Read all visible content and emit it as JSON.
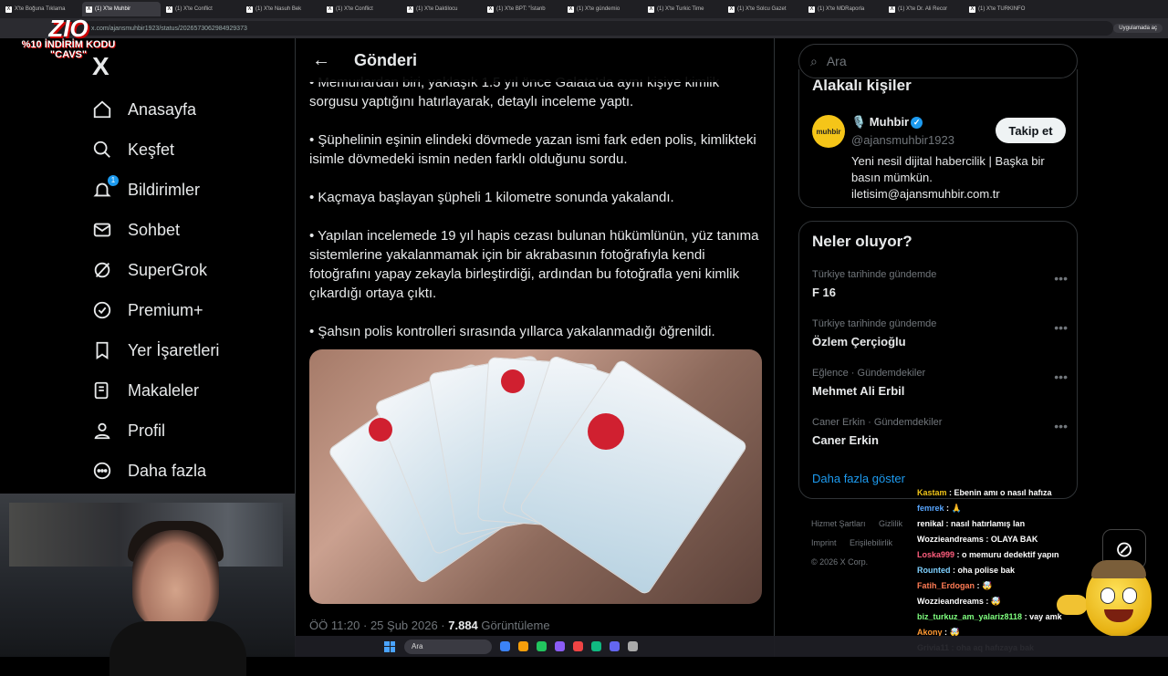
{
  "browser": {
    "tabs": [
      {
        "label": "X'te Boğuna Tıklama"
      },
      {
        "label": "(1) X'te Muhbir",
        "active": true
      },
      {
        "label": "(1) X'te Conflict"
      },
      {
        "label": "(1) X'te Nasuh Bek"
      },
      {
        "label": "(1) X'te Conflict"
      },
      {
        "label": "(1) X'te Daktilocu"
      },
      {
        "label": "(1) X'te BPT: \"İstanb"
      },
      {
        "label": "(1) X'te gündemio"
      },
      {
        "label": "(1) X'te Turkic Time"
      },
      {
        "label": "(1) X'te Solcu Gazet"
      },
      {
        "label": "(1) X'te MDRaporla"
      },
      {
        "label": "(1) X'te Dr. Ali Recor"
      },
      {
        "label": "(1) X'te TURKINFO"
      }
    ],
    "url": "x.com/ajansmuhbir1923/status/2026573062984929373",
    "app_button": "Uygulamada aç"
  },
  "overlay": {
    "brand": "ZIO",
    "promo_line1": "%10 İNDİRİM KODU",
    "promo_line2": "\"CAVS\""
  },
  "sidebar": {
    "logo": "X",
    "items": [
      {
        "label": "Anasayfa",
        "icon": "home-icon"
      },
      {
        "label": "Keşfet",
        "icon": "search-icon"
      },
      {
        "label": "Bildirimler",
        "icon": "bell-icon",
        "badge": "1"
      },
      {
        "label": "Sohbet",
        "icon": "mail-icon"
      },
      {
        "label": "SuperGrok",
        "icon": "grok-icon"
      },
      {
        "label": "Premium+",
        "icon": "verified-icon"
      },
      {
        "label": "Yer İşaretleri",
        "icon": "bookmark-icon"
      },
      {
        "label": "Makaleler",
        "icon": "article-icon"
      },
      {
        "label": "Profil",
        "icon": "user-icon"
      },
      {
        "label": "Daha fazla",
        "icon": "more-icon"
      }
    ]
  },
  "post": {
    "header_title": "Gönderi",
    "paragraphs": [
      "• Memurlardan biri, yaklaşık 1.5 yıl önce Galata'da aynı kişiye kimlik sorgusu yaptığını hatırlayarak, detaylı inceleme yaptı.",
      "• Şüphelinin eşinin elindeki dövmede yazan ismi fark eden polis, kimlikteki isimle dövmedeki ismin neden farklı olduğunu sordu.",
      "• Kaçmaya başlayan şüpheli 1 kilometre sonunda yakalandı.",
      "• Yapılan incelemede 19 yıl hapis cezası bulunan hükümlünün, yüz tanıma sistemlerine yakalanmamak için bir akrabasının fotoğrafıyla kendi fotoğrafını yapay zekayla birleştirdiği, ardından bu fotoğrafla yeni kimlik çıkardığı ortaya çıktı.",
      "• Şahsın polis kontrolleri sırasında yıllarca yakalanmadığı öğrenildi."
    ],
    "time": "ÖÖ 11:20 · 25 Şub 2026 · ",
    "views": "7.884",
    "views_label": " Görüntüleme"
  },
  "right": {
    "search_placeholder": "Ara",
    "related_title": "Alakalı kişiler",
    "account": {
      "avatar_text": "muhbir",
      "name": "🎙️ Muhbir",
      "handle": "@ajansmuhbir1923",
      "bio": "Yeni nesil dijital habercilik | Başka bir basın mümkün. iletisim@ajansmuhbir.com.tr",
      "follow_label": "Takip et"
    },
    "trends_title": "Neler oluyor?",
    "trends": [
      {
        "category": "Türkiye tarihinde gündemde",
        "name": "F 16"
      },
      {
        "category": "Türkiye tarihinde gündemde",
        "name": "Özlem Çerçioğlu"
      },
      {
        "category": "Eğlence · Gündemdekiler",
        "name": "Mehmet Ali Erbil"
      },
      {
        "category": "Caner Erkin · Gündemdekiler",
        "name": "Caner Erkin"
      }
    ],
    "show_more": "Daha fazla göster",
    "footer": [
      "Hizmet Şartları",
      "Gizlilik",
      "Erişilebilirlik",
      "Imprint",
      "© 2026 X Corp."
    ]
  },
  "chat": [
    {
      "user": "Kastam",
      "color": "#f0c419",
      "msg": "Ebenin amı o nasıl hafıza"
    },
    {
      "user": "femrek",
      "color": "#58a6ff",
      "msg": "🙏"
    },
    {
      "user": "renikal",
      "color": "#ffffff",
      "msg": "nasıl hatırlamış lan"
    },
    {
      "user": "Wozzieandreams",
      "color": "#ffffff",
      "msg": "OLAYA BAK"
    },
    {
      "user": "Loska999",
      "color": "#ff5e7e",
      "msg": "o memuru dedektif yapın"
    },
    {
      "user": "Rounted",
      "color": "#7fd1ff",
      "msg": "oha polise bak"
    },
    {
      "user": "Fatih_Erdogan",
      "color": "#ff7b54",
      "msg": "🤯"
    },
    {
      "user": "Wozzieandreams",
      "color": "#ffffff",
      "msg": "🤯"
    },
    {
      "user": "biz_turkuz_am_yalariz8118",
      "color": "#7fff7f",
      "msg": "vay amk"
    },
    {
      "user": "Akony",
      "color": "#ff9933",
      "msg": "🤯"
    },
    {
      "user": "Grivia11",
      "color": "#ffffff",
      "msg": "oha aq hafızaya bak"
    }
  ],
  "taskbar": {
    "search": "Ara"
  }
}
